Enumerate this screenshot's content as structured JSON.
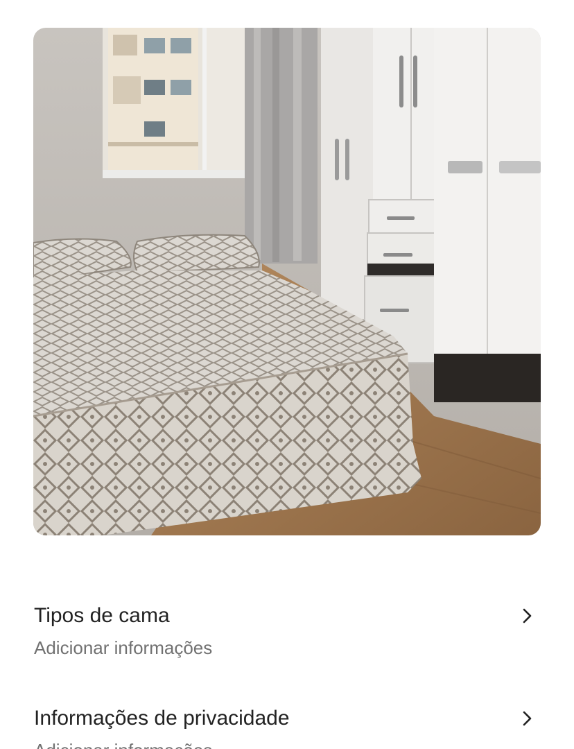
{
  "photo": {
    "alt_icon": "bedroom-photo"
  },
  "rows": [
    {
      "title": "Tipos de cama",
      "subtitle": "Adicionar informações",
      "icon": "chevron-right-icon"
    },
    {
      "title": "Informações de privacidade",
      "subtitle": "Adicionar informações",
      "icon": "chevron-right-icon"
    }
  ],
  "colors": {
    "title": "#222222",
    "subtitle": "#717171",
    "background": "#ffffff"
  }
}
